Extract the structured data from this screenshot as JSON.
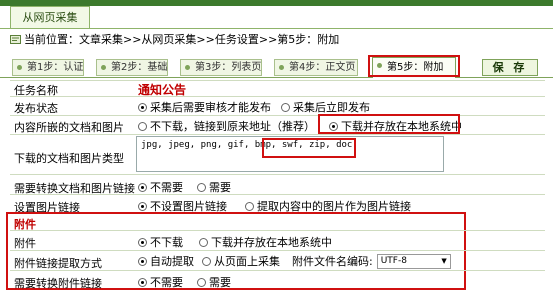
{
  "header": {
    "tab_label": "从网页采集"
  },
  "breadcrumb": {
    "text": "当前位置：文章采集>>从网页采集>>任务设置>>第5步：附加"
  },
  "steps": [
    {
      "label": "第1步：认证"
    },
    {
      "label": "第2步：基础"
    },
    {
      "label": "第3步：列表页"
    },
    {
      "label": "第4步：正文页"
    },
    {
      "label": "第5步：附加"
    }
  ],
  "toolbar": {
    "save_label": "保 存"
  },
  "form": {
    "task_name": {
      "label": "任务名称",
      "value": "通知公告"
    },
    "publish_status": {
      "label": "发布状态",
      "options": [
        "采集后需要审核才能发布",
        "采集后立即发布"
      ]
    },
    "embedded_docs": {
      "label": "内容所嵌的文档和图片",
      "options": [
        "不下载，链接到原来地址（推荐）",
        "下载并存放在本地系统中"
      ]
    },
    "download_types": {
      "label": "下载的文档和图片类型",
      "value": "jpg, jpeg, png, gif, bmp, swf, zip, doc,"
    },
    "convert_links": {
      "label": "需要转换文档和图片链接",
      "options": [
        "不需要",
        "需要"
      ]
    },
    "image_link": {
      "label": "设置图片链接",
      "options": [
        "不设置图片链接",
        "提取内容中的图片作为图片链接"
      ]
    },
    "attachment_section": {
      "title": "附件"
    },
    "attachment": {
      "label": "附件",
      "options": [
        "不下载",
        "下载并存放在本地系统中"
      ]
    },
    "attach_extract": {
      "label": "附件链接提取方式",
      "options": [
        "自动提取",
        "从页面上采集"
      ],
      "encoding_label": "附件文件名编码:",
      "encoding_value": "UTF-8"
    },
    "attach_convert": {
      "label": "需要转换附件链接",
      "options": [
        "不需要",
        "需要"
      ]
    }
  },
  "colors": {
    "accent": "#3c7a2c",
    "highlight_red": "#d01010",
    "title_red": "#c00000"
  }
}
